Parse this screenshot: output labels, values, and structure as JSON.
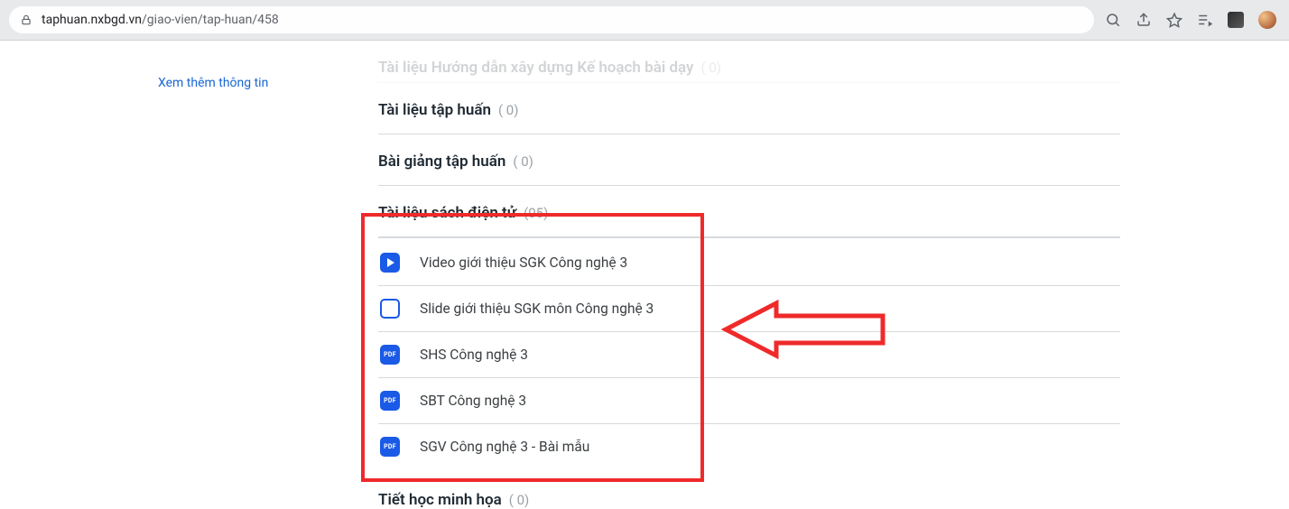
{
  "browser": {
    "url_host": "taphuan.nxbgd.vn",
    "url_path": "/giao-vien/tap-huan/458"
  },
  "sidebar": {
    "more_info": "Xem thêm thông tin"
  },
  "sections": {
    "s0": {
      "title": "Tài liệu Hướng dẫn xây dựng Kế hoạch bài dạy",
      "count": "( 0)"
    },
    "s1": {
      "title": "Tài liệu tập huấn",
      "count": "( 0)"
    },
    "s2": {
      "title": "Bài giảng tập huấn",
      "count": "( 0)"
    },
    "s3": {
      "title": "Tài liệu sách điện tử",
      "count": "(05)",
      "items": [
        {
          "icon": "video",
          "label": "Video giới thiệu SGK Công nghệ 3"
        },
        {
          "icon": "slide",
          "label": "Slide giới thiệu SGK môn Công nghệ 3"
        },
        {
          "icon": "pdf",
          "label": "SHS Công nghệ 3",
          "badge": "PDF"
        },
        {
          "icon": "pdf",
          "label": "SBT Công nghệ 3",
          "badge": "PDF"
        },
        {
          "icon": "pdf",
          "label": "SGV Công nghệ 3 - Bài mẫu",
          "badge": "PDF"
        }
      ]
    },
    "s4": {
      "title": "Tiết học minh họa",
      "count": "( 0)"
    }
  }
}
